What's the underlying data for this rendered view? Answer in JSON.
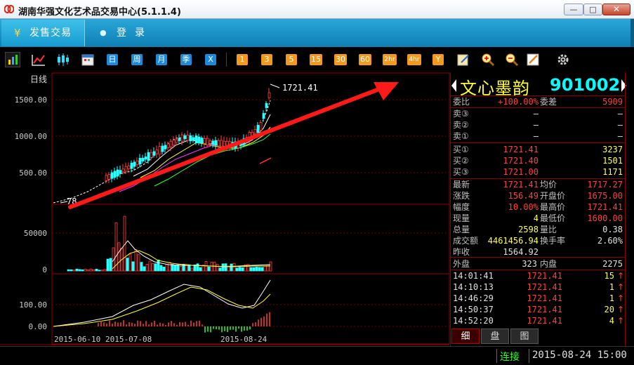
{
  "window": {
    "title": "湖南华强文化艺术品交易中心(5.1.1.4)",
    "min_glyph": "—",
    "max_glyph": "□",
    "close_glyph": "✕"
  },
  "menu": {
    "tabs": [
      {
        "label": "发售交易",
        "icon": "yen-icon",
        "icon_glyph": "¥"
      },
      {
        "label": "登录",
        "icon": "user-icon",
        "icon_glyph": "●"
      }
    ]
  },
  "toolbar": {
    "period_buttons": [
      "日",
      "周",
      "月",
      "季",
      "X"
    ],
    "minute_buttons": [
      "1",
      "3",
      "5",
      "15",
      "30",
      "60",
      "2hr",
      "4hr",
      "Y"
    ],
    "icons": [
      "bar-chart-icon",
      "line-chart-icon",
      "candlestick-icon",
      "calendar-icon",
      "edit-icon",
      "zoom-in-icon",
      "zoom-out-icon",
      "pencil-icon",
      "settings-icon"
    ]
  },
  "chart": {
    "period_label": "日线",
    "price_ticks": [
      "1500.00",
      "1000.00",
      "500.00"
    ],
    "volume_ticks": [
      "50000",
      "0"
    ],
    "indicator_ticks": [
      "100.00",
      "0.00"
    ],
    "x_dates": [
      "2015-06-10",
      "2015-07-08",
      "2015-08-24"
    ],
    "last_price_label": "1721.41",
    "low_label": "78"
  },
  "chart_data": {
    "type": "candlestick",
    "x_labels": [
      "2015-06-10",
      "2015-07-08",
      "2015-08-24"
    ],
    "price_ylim": [
      0,
      1800
    ],
    "price_ticks": [
      500,
      1000,
      1500
    ],
    "last_price": 1721.41,
    "annotations": [
      "1721.41",
      "78"
    ],
    "volume_ticks": [
      0,
      50000
    ],
    "indicator_ticks": [
      0,
      100
    ]
  },
  "quote": {
    "name": "文心墨韵",
    "code": "901002",
    "weibi_label": "委比",
    "weibi_value": "+100.00%",
    "weicha_label": "委差",
    "weicha_value": "5909",
    "sells": [
      {
        "label": "卖③",
        "price": "—",
        "vol": "—"
      },
      {
        "label": "卖②",
        "price": "—",
        "vol": "—"
      },
      {
        "label": "卖①",
        "price": "—",
        "vol": "—"
      }
    ],
    "buys": [
      {
        "label": "买①",
        "price": "1721.41",
        "vol": "3237"
      },
      {
        "label": "买②",
        "price": "1721.40",
        "vol": "1501"
      },
      {
        "label": "买③",
        "price": "1721.00",
        "vol": "1171"
      }
    ],
    "stats": [
      {
        "l1": "最新",
        "v1": "1721.41",
        "l2": "均价",
        "v2": "1717.27"
      },
      {
        "l1": "涨跌",
        "v1": "156.49",
        "l2": "开盘价",
        "v2": "1675.00"
      },
      {
        "l1": "幅度",
        "v1": "10.00%",
        "l2": "最高价",
        "v2": "1721.41"
      },
      {
        "l1": "现量",
        "v1": "4",
        "l2": "最低价",
        "v2": "1600.00"
      },
      {
        "l1": "总量",
        "v1": "2598",
        "l2": "量比",
        "v2": "0.38"
      },
      {
        "l1": "成交额",
        "v1": "4461456.94",
        "l2": "换手率",
        "v2": "2.60%"
      },
      {
        "l1": "昨收",
        "v1": "1564.92",
        "l2": "",
        "v2": ""
      }
    ],
    "waipan_label": "外盘",
    "waipan_value": "323",
    "neipan_label": "内盘",
    "neipan_value": "2275",
    "ticks": [
      {
        "time": "14:01:41",
        "price": "1721.41",
        "vol": "15"
      },
      {
        "time": "14:10:13",
        "price": "1721.41",
        "vol": "1"
      },
      {
        "time": "14:46:29",
        "price": "1721.41",
        "vol": "1"
      },
      {
        "time": "14:50:37",
        "price": "1721.41",
        "vol": "20"
      },
      {
        "time": "14:52:20",
        "price": "1721.41",
        "vol": "4"
      }
    ],
    "tick_arrow": "↑"
  },
  "bottom_tabs": [
    "细",
    "盘",
    "图"
  ],
  "status": {
    "connection": "连接",
    "datetime": "2015-08-24 15:00"
  },
  "colors": {
    "up": "#ff4040",
    "down": "#33ffff",
    "grid": "#8b0000",
    "annotation_arrow": "#ff1a1a"
  }
}
